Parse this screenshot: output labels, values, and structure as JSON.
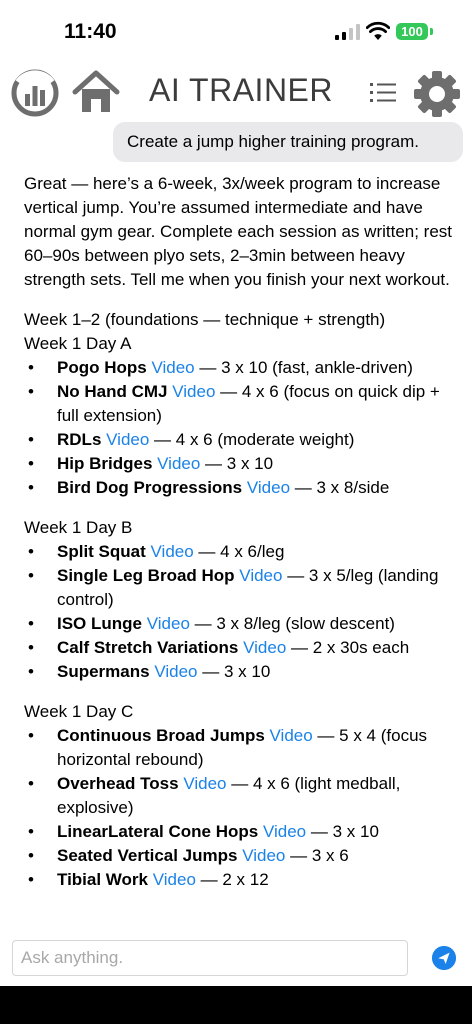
{
  "status_bar": {
    "time": "11:40",
    "battery": "100"
  },
  "nav": {
    "title": "AI TRAINER"
  },
  "user_message": "Create a jump higher training program.",
  "response": {
    "intro": "Great — here’s a 6-week, 3x/week program to increase vertical jump. You’re assumed intermediate and have normal gym gear. Complete each session as written; rest 60–90s between plyo sets, 2–3min between heavy strength sets. Tell me when you finish your next workout.",
    "sections": [
      {
        "lines": [
          "Week 1–2 (foundations — technique + strength)",
          "Week 1 Day A"
        ],
        "items": [
          {
            "name": "Pogo Hops",
            "link": "Video",
            "detail": " — 3 x 10 (fast, ankle-driven)"
          },
          {
            "name": "No Hand CMJ",
            "link": "Video",
            "detail": " — 4 x 6 (focus on quick dip + full extension)"
          },
          {
            "name": "RDLs",
            "link": "Video",
            "detail": " — 4 x 6 (moderate weight)"
          },
          {
            "name": "Hip Bridges",
            "link": "Video",
            "detail": " — 3 x 10"
          },
          {
            "name": "Bird Dog Progressions",
            "link": "Video",
            "detail": " — 3 x 8/side"
          }
        ]
      },
      {
        "lines": [
          "Week 1 Day B"
        ],
        "items": [
          {
            "name": "Split Squat",
            "link": "Video",
            "detail": " — 4 x 6/leg"
          },
          {
            "name": "Single Leg Broad Hop",
            "link": "Video",
            "detail": " — 3 x 5/leg (landing control)"
          },
          {
            "name": "ISO Lunge",
            "link": "Video",
            "detail": " — 3 x 8/leg (slow descent)"
          },
          {
            "name": "Calf Stretch Variations",
            "link": "Video",
            "detail": " — 2 x 30s each"
          },
          {
            "name": "Supermans",
            "link": "Video",
            "detail": " — 3 x 10"
          }
        ]
      },
      {
        "lines": [
          "Week 1 Day C"
        ],
        "items": [
          {
            "name": "Continuous Broad Jumps",
            "link": "Video",
            "detail": " — 5 x 4 (focus horizontal rebound)"
          },
          {
            "name": "Overhead Toss",
            "link": "Video",
            "detail": " — 4 x 6 (light medball, explosive)"
          },
          {
            "name": "LinearLateral Cone Hops",
            "link": "Video",
            "detail": " — 3 x 10"
          },
          {
            "name": "Seated Vertical Jumps",
            "link": "Video",
            "detail": " — 3 x 6"
          },
          {
            "name": "Tibial Work",
            "link": "Video",
            "detail": " — 2 x 12"
          }
        ]
      }
    ]
  },
  "composer": {
    "placeholder": "Ask anything."
  },
  "colors": {
    "link": "#1a82e8",
    "bubble": "#e9e9eb",
    "battery": "#34c759",
    "icon_gray": "#6e6e6e"
  }
}
